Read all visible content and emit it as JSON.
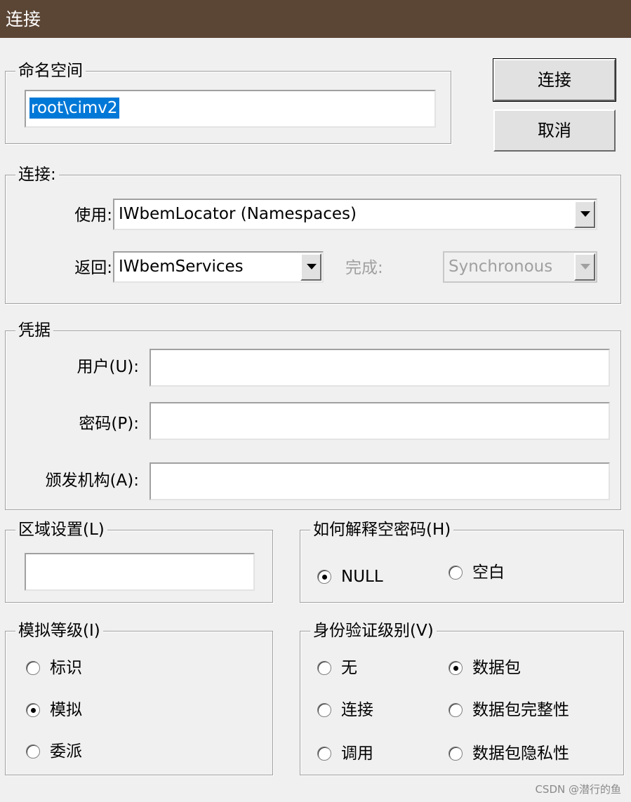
{
  "window": {
    "title": "连接"
  },
  "namespace": {
    "legend": "命名空间",
    "value": "root\\cimv2"
  },
  "buttons": {
    "connect": "连接",
    "cancel": "取消"
  },
  "connection": {
    "legend": "连接:",
    "use_label": "使用:",
    "use_value": "IWbemLocator (Namespaces)",
    "return_label": "返回:",
    "return_value": "IWbemServices",
    "complete_label": "完成:",
    "complete_value": "Synchronous"
  },
  "credentials": {
    "legend": "凭据",
    "user_label": "用户(U):",
    "password_label": "密码(P):",
    "authority_label": "颁发机构(A):",
    "user_value": "",
    "password_value": "",
    "authority_value": ""
  },
  "locale": {
    "legend": "区域设置(L)",
    "value": ""
  },
  "null_password": {
    "legend": "如何解释空密码(H)",
    "options": [
      {
        "label": "NULL",
        "selected": true
      },
      {
        "label": "空白",
        "selected": false
      }
    ]
  },
  "impersonation": {
    "legend": "模拟等级(I)",
    "options": [
      {
        "label": "标识",
        "selected": false
      },
      {
        "label": "模拟",
        "selected": true
      },
      {
        "label": "委派",
        "selected": false
      }
    ]
  },
  "authentication": {
    "legend": "身份验证级别(V)",
    "options": [
      {
        "label": "无",
        "selected": false
      },
      {
        "label": "数据包",
        "selected": true
      },
      {
        "label": "连接",
        "selected": false
      },
      {
        "label": "数据包完整性",
        "selected": false
      },
      {
        "label": "调用",
        "selected": false
      },
      {
        "label": "数据包隐私性",
        "selected": false
      }
    ]
  },
  "watermark": "CSDN @潜行的鱼"
}
